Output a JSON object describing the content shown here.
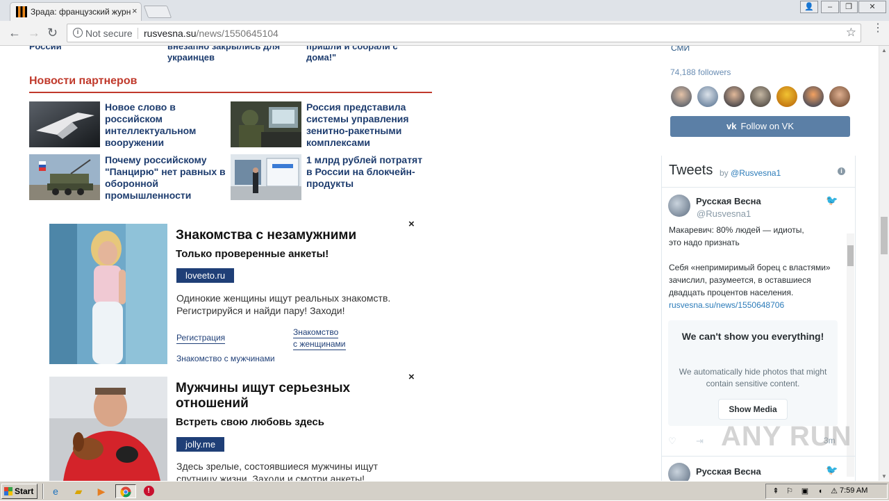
{
  "browser": {
    "tab_title": "Зрада: французский журн",
    "tab_close": "×",
    "window_buttons": [
      "👤",
      "–",
      "❐",
      "✕"
    ],
    "back": "←",
    "forward": "→",
    "reload": "↻",
    "security_label": "Not secure",
    "url_domain": "rusvesna.su",
    "url_path": "/news/1550645104",
    "bookmark": "☆",
    "menu": "⋮"
  },
  "top_cut": {
    "col1": "России",
    "col2": "внезапно закрылись для украинцев",
    "col3": "пришли и собрали с дома!\""
  },
  "partners": {
    "title": "Новости партнеров",
    "items": [
      {
        "title": "Новое слово в российском интеллектуальном вооружении",
        "thumb": "drone-image"
      },
      {
        "title": "Россия представила системы управления зенитно-ракетными комплексами",
        "thumb": "soldier-console-image"
      },
      {
        "title": "Почему российскому \"Панцирю\" нет равных в оборонной промышленности",
        "thumb": "pantsir-image"
      },
      {
        "title": "1 млрд рублей потратят в России на блокчейн-продукты",
        "thumb": "office-image"
      }
    ]
  },
  "ads": [
    {
      "close": "×",
      "title": "Знакомства с незамужними",
      "subtitle": "Только проверенные анкеты!",
      "domain": "loveeto.ru",
      "description": "Одинокие женщины ищут реальных знакомств. Регистрируйся и найди пару! Заходи!",
      "link1": "Регистрация",
      "link2_line1": "Знакомство",
      "link2_line2": "с женщинами",
      "link3": "Знакомство с мужчинами"
    },
    {
      "close": "×",
      "title": "Мужчины ищут серьезных отношений",
      "subtitle": "Встреть свою любовь здесь",
      "domain": "jolly.me",
      "description": "Здесь зрелые, состоявшиеся мужчины ищут спутницу жизни. Заходи и смотри анкеты!"
    }
  ],
  "vk": {
    "cut_label": "СМИ",
    "followers": "74,188 followers",
    "follow_button": "Follow on VK"
  },
  "twitter": {
    "header": "Tweets",
    "by": "by",
    "handle_link": "@Rusvesna1",
    "info": "i",
    "tweet": {
      "name": "Русская Весна",
      "handle": "@Rusvesna1",
      "line1": "Макаревич: 80% людей — идиоты,",
      "line2": "это надо признать",
      "line3": "Себя «непримиримый борец с властями»",
      "line4": "зачислил, разумеется, в оставшиеся",
      "line5": "двадцать процентов населения.",
      "link": "rusvesna.su/news/1550648706"
    },
    "sensitive": {
      "title": "We can't show you everything!",
      "text": "We automatically hide photos that might contain sensitive content.",
      "button": "Show Media"
    },
    "time": "3m",
    "next_name": "Русская Весна"
  },
  "watermark": "ANY RUN",
  "taskbar": {
    "start": "Start",
    "clock": "7:59 AM"
  }
}
